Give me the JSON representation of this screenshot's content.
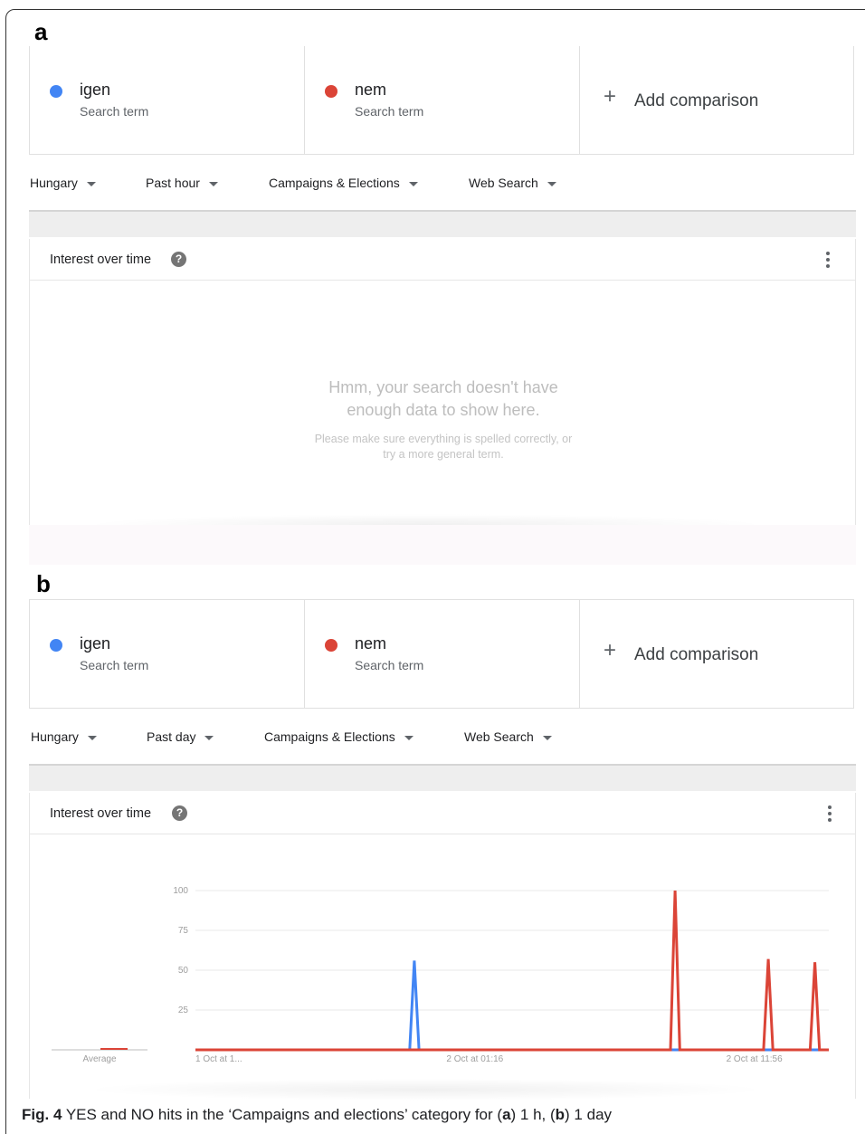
{
  "colors": {
    "term1": "#4285f4",
    "term2": "#db4437"
  },
  "panel_a": {
    "letter": "a",
    "terms": [
      {
        "name": "igen",
        "sub": "Search term",
        "dot_icon": "blue-dot-icon"
      },
      {
        "name": "nem",
        "sub": "Search term",
        "dot_icon": "red-dot-icon"
      }
    ],
    "add_comparison": "Add comparison",
    "filters": {
      "region": "Hungary",
      "time": "Past hour",
      "category": "Campaigns & Elections",
      "property": "Web Search"
    },
    "card_title": "Interest over time",
    "empty_main_1": "Hmm, your search doesn't have",
    "empty_main_2": "enough data to show here.",
    "empty_sub_1": "Please make sure everything is spelled correctly, or",
    "empty_sub_2": "try a more general term."
  },
  "panel_b": {
    "letter": "b",
    "terms": [
      {
        "name": "igen",
        "sub": "Search term",
        "dot_icon": "blue-dot-icon"
      },
      {
        "name": "nem",
        "sub": "Search term",
        "dot_icon": "red-dot-icon"
      }
    ],
    "add_comparison": "Add comparison",
    "filters": {
      "region": "Hungary",
      "time": "Past day",
      "category": "Campaigns & Elections",
      "property": "Web Search"
    },
    "card_title": "Interest over time"
  },
  "chart_data": {
    "type": "line",
    "average_label": "Average",
    "x_tick_labels": [
      "1 Oct at 1...",
      "2 Oct at 01:16",
      "2 Oct at 11:56"
    ],
    "x_tick_index": [
      0,
      60,
      120
    ],
    "y_ticks": [
      25,
      50,
      75,
      100
    ],
    "ylim": [
      0,
      100
    ],
    "n_points": 137,
    "series": [
      {
        "name": "igen",
        "spikes": [
          {
            "index": 47,
            "value": 56
          }
        ]
      },
      {
        "name": "nem",
        "spikes": [
          {
            "index": 103,
            "value": 100
          },
          {
            "index": 123,
            "value": 57
          },
          {
            "index": 133,
            "value": 55
          }
        ]
      }
    ]
  },
  "caption": {
    "label": "Fig. 4",
    "text_1": " YES and NO hits in the ‘Campaigns and elections’ category for (",
    "a": "a",
    "text_2": ") 1 h, (",
    "b": "b",
    "text_3": ") 1 day"
  }
}
